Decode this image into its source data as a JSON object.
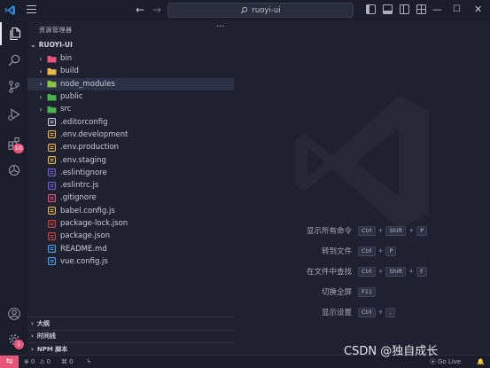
{
  "titlebar": {
    "search_text": "ruoyi-ui",
    "back_glyph": "←",
    "forward_glyph": "→",
    "minimize_glyph": "—",
    "maximize_glyph": "☐",
    "close_glyph": "✕"
  },
  "activity": {
    "extensions_badge": "10",
    "accounts_badge": "1"
  },
  "explorer": {
    "title": "资源管理器",
    "more_glyph": "···",
    "root": "RUOYI-UI",
    "items": [
      {
        "name": "bin",
        "type": "folder",
        "icon_color": "#e9547b"
      },
      {
        "name": "build",
        "type": "folder",
        "icon_color": "#e8b84a"
      },
      {
        "name": "node_modules",
        "type": "folder",
        "icon_color": "#8bc34a"
      },
      {
        "name": "public",
        "type": "folder",
        "icon_color": "#4caf50"
      },
      {
        "name": "src",
        "type": "folder",
        "icon_color": "#4caf50"
      },
      {
        "name": ".editorconfig",
        "type": "file",
        "icon_color": "#c9ccd8"
      },
      {
        "name": ".env.development",
        "type": "file",
        "icon_color": "#e8b84a"
      },
      {
        "name": ".env.production",
        "type": "file",
        "icon_color": "#e8b84a"
      },
      {
        "name": ".env.staging",
        "type": "file",
        "icon_color": "#e8b84a"
      },
      {
        "name": ".eslintignore",
        "type": "file",
        "icon_color": "#6c63d9"
      },
      {
        "name": ".eslintrc.js",
        "type": "file",
        "icon_color": "#6c63d9"
      },
      {
        "name": ".gitignore",
        "type": "file",
        "icon_color": "#e9547b"
      },
      {
        "name": "babel.config.js",
        "type": "file",
        "icon_color": "#e8b84a"
      },
      {
        "name": "package-lock.json",
        "type": "file",
        "icon_color": "#d0463c"
      },
      {
        "name": "package.json",
        "type": "file",
        "icon_color": "#d0463c"
      },
      {
        "name": "README.md",
        "type": "file",
        "icon_color": "#4aa3e8"
      },
      {
        "name": "vue.config.js",
        "type": "file",
        "icon_color": "#4aa3e8"
      }
    ],
    "sections": [
      "大纲",
      "时间线",
      "NPM 脚本"
    ]
  },
  "shortcuts": [
    {
      "label": "显示所有命令",
      "keys": [
        "Ctrl",
        "Shift",
        "P"
      ]
    },
    {
      "label": "转到文件",
      "keys": [
        "Ctrl",
        "P"
      ]
    },
    {
      "label": "在文件中查找",
      "keys": [
        "Ctrl",
        "Shift",
        "F"
      ]
    },
    {
      "label": "切换全屏",
      "keys": [
        "F11"
      ]
    },
    {
      "label": "显示设置",
      "keys": [
        "Ctrl",
        ","
      ]
    }
  ],
  "statusbar": {
    "remote_glyph": "⇆",
    "errors": "0",
    "warnings": "0",
    "info": "0",
    "golive": "Go Live"
  },
  "watermark_text": "CSDN @独自成长",
  "colors": {
    "accent": "#e9547b",
    "vscode_blue": "#2f8ee9"
  }
}
